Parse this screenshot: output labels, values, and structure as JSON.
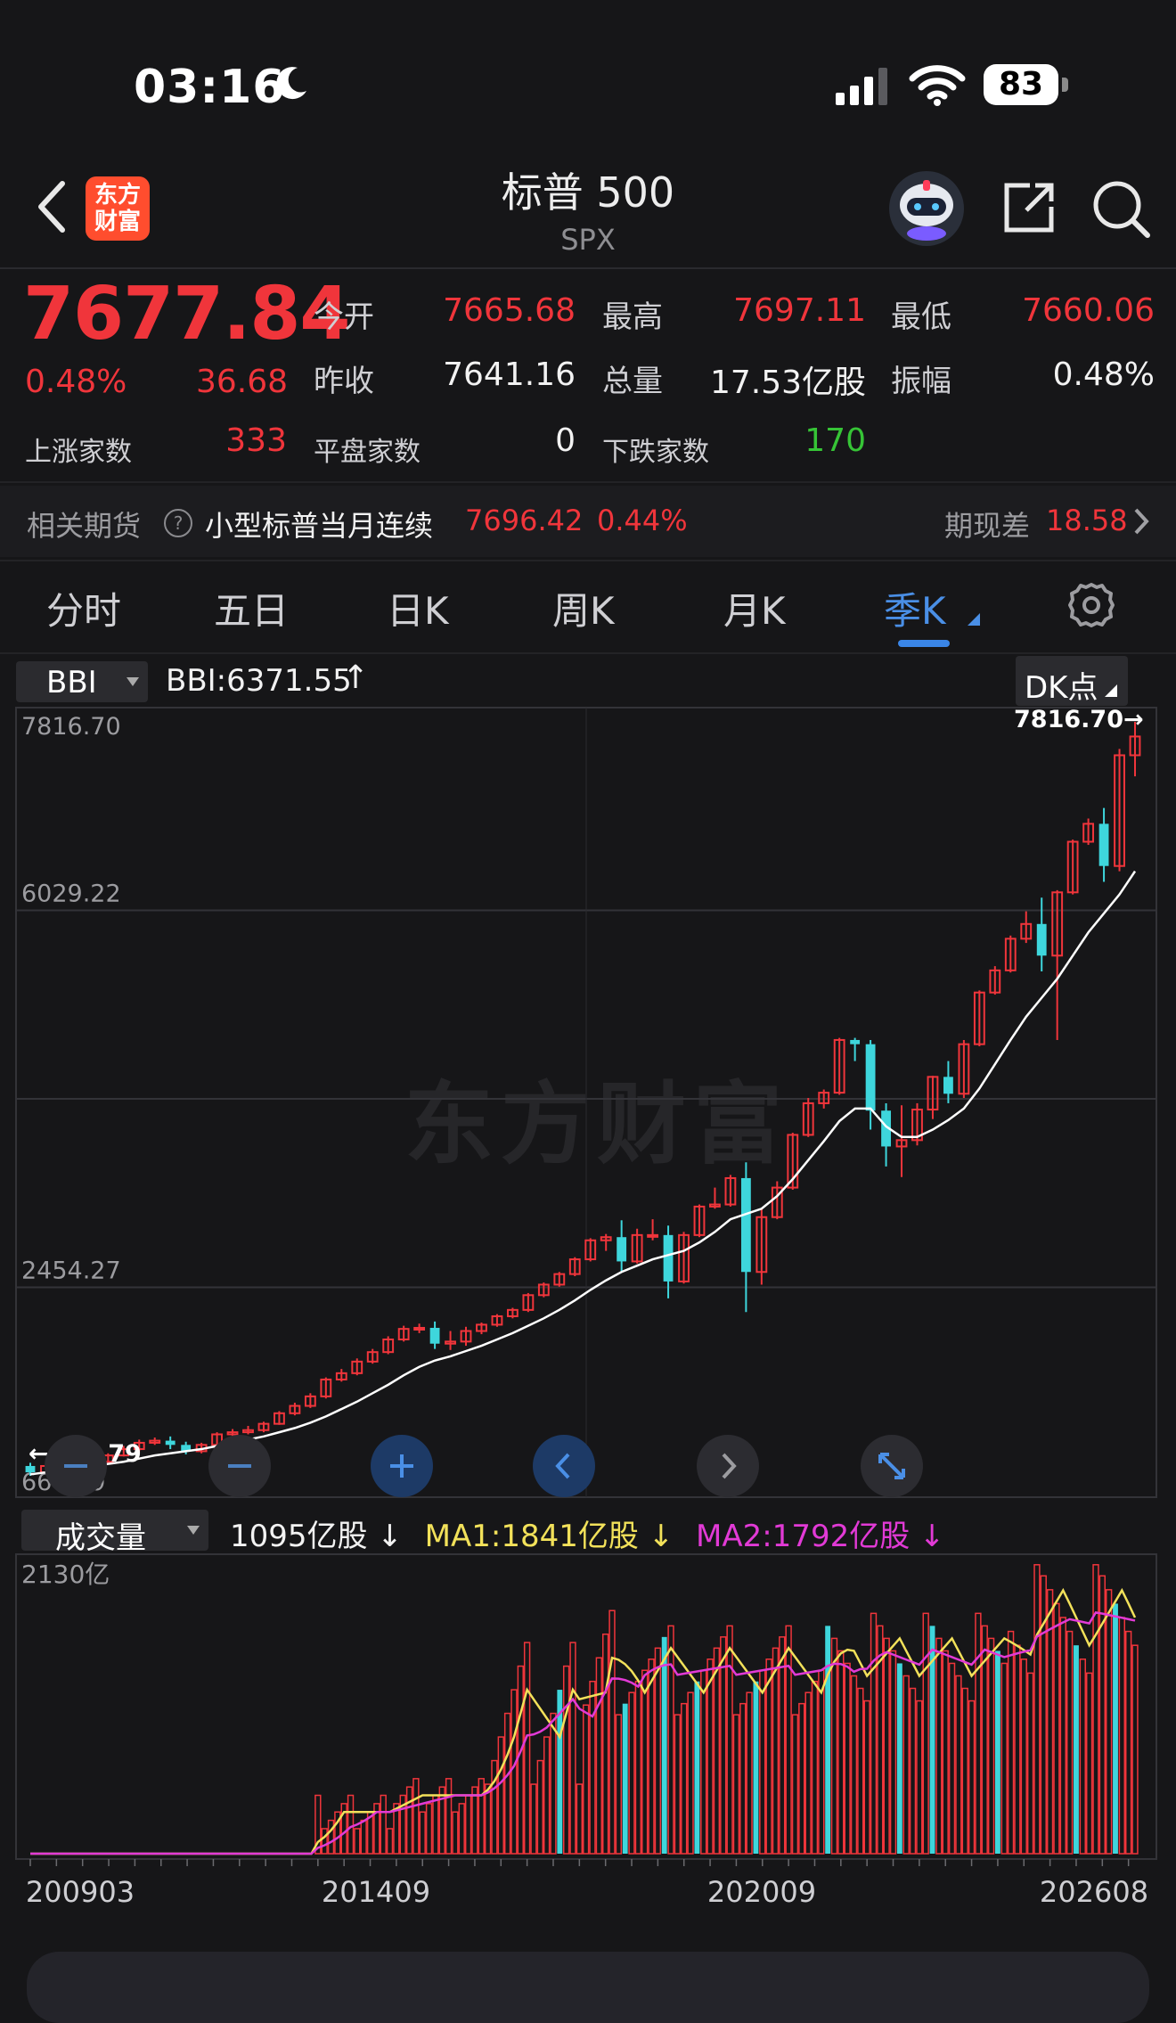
{
  "status_bar": {
    "time": "03:16",
    "battery": "83"
  },
  "header": {
    "title": "标普 500",
    "subtitle": "SPX",
    "logo_text_top": "东方",
    "logo_text_bottom": "财富"
  },
  "quote": {
    "price": "7677.84",
    "change_pct": "0.48%",
    "change": "36.68",
    "open_label": "今开",
    "open": "7665.68",
    "high_label": "最高",
    "high": "7697.11",
    "low_label": "最低",
    "low": "7660.06",
    "prev_close_label": "昨收",
    "prev_close": "7641.16",
    "volume_label": "总量",
    "volume": "17.53亿股",
    "amplitude_label": "振幅",
    "amplitude": "0.48%",
    "advance_label": "上涨家数",
    "advance": "333",
    "unchanged_label": "平盘家数",
    "unchanged": "0",
    "decline_label": "下跌家数",
    "decline": "170"
  },
  "futures": {
    "label": "相关期货",
    "help_icon": "?",
    "name": "小型标普当月连续",
    "price": "7696.42",
    "pct": "0.44%",
    "basis_label": "期现差",
    "basis": "18.58"
  },
  "tabs": [
    "分时",
    "五日",
    "日K",
    "周K",
    "月K",
    "季K"
  ],
  "active_tab": 5,
  "indicator": {
    "name": "BBI",
    "value_text": "BBI:6371.55",
    "arrow": "↑",
    "dk_label": "DK点"
  },
  "axis": {
    "y_top": "7816.70",
    "y_mid": "6029.22",
    "y_low": "2454.27",
    "y_min": "666.79",
    "max_marker": "7816.70",
    "min_marker": "666.79"
  },
  "watermark": "东方财富",
  "volume": {
    "name": "成交量",
    "current": "1095亿股",
    "current_arrow": "↓",
    "ma1": "MA1:1841亿股",
    "ma1_arrow": "↓",
    "ma2": "MA2:1792亿股",
    "ma2_arrow": "↓",
    "y_top": "2130亿",
    "x_labels": [
      "200903",
      "201409",
      "202009",
      "202608"
    ]
  },
  "colors": {
    "up": "#f0353b",
    "down": "#3ed6dc",
    "bbi": "#ffffff",
    "ma1": "#f2e15a",
    "ma2": "#e23ad6",
    "accent": "#3a86e8"
  },
  "chart_data": {
    "type": "candlestick",
    "title": "",
    "y_range": [
      666.79,
      7816.7
    ],
    "candles": [
      {
        "o": 760,
        "c": 700,
        "h": 790,
        "l": 666.79
      },
      {
        "o": 700,
        "c": 760,
        "h": 790,
        "l": 690
      },
      {
        "o": 760,
        "c": 790,
        "h": 810,
        "l": 740
      },
      {
        "o": 790,
        "c": 860,
        "h": 880,
        "l": 770
      },
      {
        "o": 860,
        "c": 800,
        "h": 900,
        "l": 780
      },
      {
        "o": 800,
        "c": 860,
        "h": 880,
        "l": 790
      },
      {
        "o": 860,
        "c": 920,
        "h": 950,
        "l": 850
      },
      {
        "o": 920,
        "c": 980,
        "h": 1010,
        "l": 900
      },
      {
        "o": 980,
        "c": 1000,
        "h": 1030,
        "l": 960
      },
      {
        "o": 1000,
        "c": 960,
        "h": 1040,
        "l": 920
      },
      {
        "o": 960,
        "c": 900,
        "h": 990,
        "l": 870
      },
      {
        "o": 900,
        "c": 960,
        "h": 980,
        "l": 880
      },
      {
        "o": 960,
        "c": 1060,
        "h": 1080,
        "l": 950
      },
      {
        "o": 1060,
        "c": 1080,
        "h": 1110,
        "l": 1040
      },
      {
        "o": 1080,
        "c": 1100,
        "h": 1140,
        "l": 1060
      },
      {
        "o": 1100,
        "c": 1160,
        "h": 1180,
        "l": 1080
      },
      {
        "o": 1160,
        "c": 1260,
        "h": 1280,
        "l": 1150
      },
      {
        "o": 1260,
        "c": 1330,
        "h": 1360,
        "l": 1240
      },
      {
        "o": 1330,
        "c": 1420,
        "h": 1450,
        "l": 1310
      },
      {
        "o": 1420,
        "c": 1580,
        "h": 1600,
        "l": 1400
      },
      {
        "o": 1580,
        "c": 1640,
        "h": 1680,
        "l": 1560
      },
      {
        "o": 1640,
        "c": 1750,
        "h": 1780,
        "l": 1620
      },
      {
        "o": 1750,
        "c": 1840,
        "h": 1870,
        "l": 1730
      },
      {
        "o": 1840,
        "c": 1960,
        "h": 1990,
        "l": 1820
      },
      {
        "o": 1960,
        "c": 2060,
        "h": 2090,
        "l": 1940
      },
      {
        "o": 2060,
        "c": 2070,
        "h": 2110,
        "l": 2020
      },
      {
        "o": 2070,
        "c": 1920,
        "h": 2130,
        "l": 1870
      },
      {
        "o": 1920,
        "c": 1940,
        "h": 2040,
        "l": 1860
      },
      {
        "o": 1940,
        "c": 2040,
        "h": 2080,
        "l": 1900
      },
      {
        "o": 2040,
        "c": 2100,
        "h": 2120,
        "l": 2010
      },
      {
        "o": 2100,
        "c": 2180,
        "h": 2200,
        "l": 2080
      },
      {
        "o": 2180,
        "c": 2240,
        "h": 2260,
        "l": 2160
      },
      {
        "o": 2240,
        "c": 2380,
        "h": 2400,
        "l": 2220
      },
      {
        "o": 2380,
        "c": 2480,
        "h": 2500,
        "l": 2360
      },
      {
        "o": 2480,
        "c": 2580,
        "h": 2600,
        "l": 2460
      },
      {
        "o": 2580,
        "c": 2720,
        "h": 2740,
        "l": 2560
      },
      {
        "o": 2720,
        "c": 2900,
        "h": 2920,
        "l": 2700
      },
      {
        "o": 2900,
        "c": 2930,
        "h": 2960,
        "l": 2800
      },
      {
        "o": 2930,
        "c": 2700,
        "h": 3090,
        "l": 2600
      },
      {
        "o": 2700,
        "c": 2950,
        "h": 3010,
        "l": 2680
      },
      {
        "o": 2950,
        "c": 2950,
        "h": 3100,
        "l": 2900
      },
      {
        "o": 2950,
        "c": 2510,
        "h": 3040,
        "l": 2350
      },
      {
        "o": 2510,
        "c": 2950,
        "h": 2980,
        "l": 2490
      },
      {
        "o": 2950,
        "c": 3220,
        "h": 3240,
        "l": 2930
      },
      {
        "o": 3220,
        "c": 3240,
        "h": 3400,
        "l": 3200
      },
      {
        "o": 3240,
        "c": 3490,
        "h": 3520,
        "l": 3220
      },
      {
        "o": 3490,
        "c": 2600,
        "h": 3640,
        "l": 2220
      },
      {
        "o": 2600,
        "c": 3120,
        "h": 3200,
        "l": 2480
      },
      {
        "o": 3120,
        "c": 3400,
        "h": 3460,
        "l": 3100
      },
      {
        "o": 3400,
        "c": 3900,
        "h": 3920,
        "l": 3380
      },
      {
        "o": 3900,
        "c": 4200,
        "h": 4250,
        "l": 3880
      },
      {
        "o": 4200,
        "c": 4300,
        "h": 4330,
        "l": 4150
      },
      {
        "o": 4300,
        "c": 4800,
        "h": 4820,
        "l": 4280
      },
      {
        "o": 4800,
        "c": 4760,
        "h": 4820,
        "l": 4600
      },
      {
        "o": 4760,
        "c": 4130,
        "h": 4800,
        "l": 3950
      },
      {
        "o": 4130,
        "c": 3790,
        "h": 4200,
        "l": 3600
      },
      {
        "o": 3790,
        "c": 3850,
        "h": 4180,
        "l": 3500
      },
      {
        "o": 3850,
        "c": 4140,
        "h": 4200,
        "l": 3800
      },
      {
        "o": 4140,
        "c": 4450,
        "h": 4460,
        "l": 4050
      },
      {
        "o": 4450,
        "c": 4290,
        "h": 4600,
        "l": 4200
      },
      {
        "o": 4290,
        "c": 4760,
        "h": 4800,
        "l": 4250
      },
      {
        "o": 4760,
        "c": 5250,
        "h": 5270,
        "l": 4740
      },
      {
        "o": 5250,
        "c": 5460,
        "h": 5500,
        "l": 5230
      },
      {
        "o": 5460,
        "c": 5760,
        "h": 5790,
        "l": 5440
      },
      {
        "o": 5760,
        "c": 5900,
        "h": 6020,
        "l": 5720
      },
      {
        "o": 5900,
        "c": 5600,
        "h": 6150,
        "l": 5450
      },
      {
        "o": 5600,
        "c": 6200,
        "h": 6220,
        "l": 4800
      },
      {
        "o": 6200,
        "c": 6680,
        "h": 6700,
        "l": 6180
      },
      {
        "o": 6680,
        "c": 6850,
        "h": 6900,
        "l": 6650
      },
      {
        "o": 6850,
        "c": 6450,
        "h": 7000,
        "l": 6300
      },
      {
        "o": 6450,
        "c": 7500,
        "h": 7560,
        "l": 6400
      },
      {
        "o": 7500,
        "c": 7677.84,
        "h": 7816.7,
        "l": 7300
      }
    ],
    "bbi": [
      680,
      700,
      720,
      740,
      760,
      780,
      800,
      830,
      860,
      880,
      900,
      920,
      950,
      980,
      1010,
      1040,
      1080,
      1120,
      1170,
      1230,
      1300,
      1370,
      1450,
      1530,
      1620,
      1700,
      1760,
      1800,
      1850,
      1900,
      1960,
      2020,
      2090,
      2160,
      2240,
      2330,
      2430,
      2520,
      2600,
      2660,
      2720,
      2760,
      2800,
      2880,
      2980,
      3100,
      3150,
      3200,
      3320,
      3480,
      3660,
      3840,
      4030,
      4150,
      4150,
      3980,
      3880,
      3880,
      3950,
      4040,
      4150,
      4340,
      4570,
      4800,
      5020,
      5200,
      5380,
      5600,
      5820,
      6000,
      6180,
      6400
    ],
    "volume_ylim": [
      0,
      2130
    ],
    "volume_up": [
      true,
      true,
      true,
      true,
      true,
      true,
      true,
      true,
      true,
      true,
      true,
      true,
      true,
      true,
      true,
      true,
      false,
      true,
      true,
      true,
      true,
      true,
      true,
      true,
      true,
      true,
      false,
      false,
      true,
      true,
      true,
      true,
      true,
      true,
      true,
      true,
      true,
      true,
      true,
      false,
      true,
      true,
      false,
      true,
      true,
      true,
      true,
      true,
      true,
      true,
      true,
      true,
      true,
      true,
      true,
      true,
      true,
      true,
      true,
      true,
      true,
      true,
      true,
      true,
      true,
      true,
      true,
      true,
      true,
      true,
      true,
      true,
      true,
      true,
      true,
      true,
      true,
      true,
      true,
      true,
      true,
      false,
      true,
      true,
      true,
      true,
      true,
      true,
      true,
      true,
      true,
      false,
      true,
      true,
      true,
      true,
      true,
      false,
      true,
      true,
      true,
      true,
      false,
      true,
      true,
      true,
      true,
      true,
      true,
      true,
      true,
      false,
      true,
      true,
      true,
      true,
      true,
      true,
      true,
      true,
      true,
      true,
      false,
      true,
      true,
      true,
      true,
      true,
      true,
      true,
      true,
      true,
      true,
      false,
      true,
      true,
      true,
      true,
      false,
      true,
      true,
      true,
      true,
      true,
      true,
      true,
      true,
      true,
      false,
      true,
      true,
      true,
      true,
      true,
      true,
      true,
      true,
      true,
      true,
      true,
      false,
      true,
      true,
      true,
      true,
      true,
      false,
      true,
      true,
      true
    ],
    "x_labels": [
      "200903",
      "201409",
      "202009",
      "202608"
    ]
  }
}
